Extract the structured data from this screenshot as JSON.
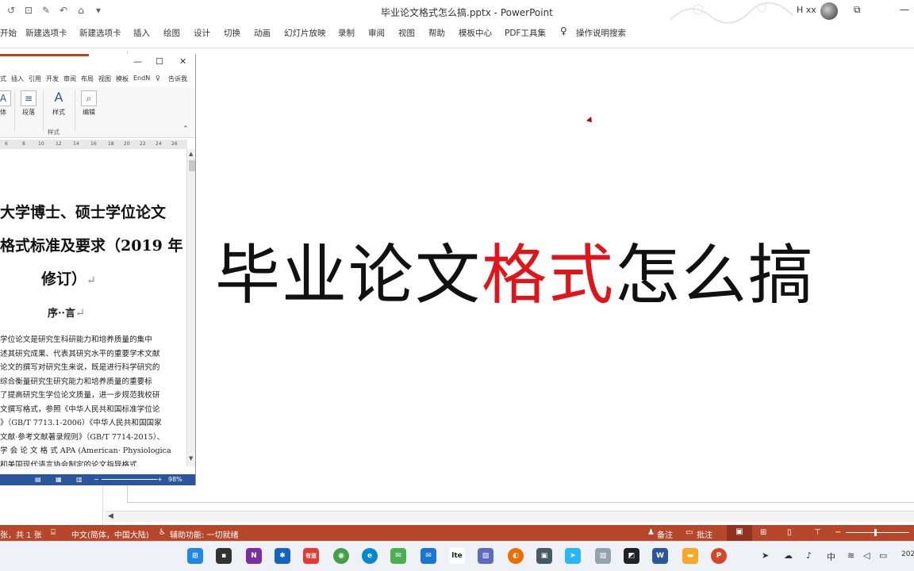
{
  "ppt": {
    "window_title": "毕业论文格式怎么搞.pptx  -  PowerPoint",
    "user_name": "H xx",
    "tabs": [
      "开始",
      "新建选项卡",
      "新建选项卡",
      "插入",
      "绘图",
      "设计",
      "切换",
      "动画",
      "幻灯片放映",
      "录制",
      "审阅",
      "视图",
      "帮助",
      "模板中心",
      "PDF工具集"
    ],
    "tell_me": "操作说明搜索"
  },
  "slide": {
    "title_part1": "毕业论文",
    "title_highlight": "格式",
    "title_part2": "怎么搞",
    "highlight_color": "#e0141b"
  },
  "word": {
    "tabs": [
      "式",
      "插入",
      "引用",
      "开发",
      "审阅",
      "布局",
      "视图",
      "模板",
      "EndN",
      "告诉我"
    ],
    "ribbon": {
      "btn_font": "体",
      "btn_paragraph": "段落",
      "btn_style": "样式",
      "btn_edit": "编辑",
      "group_style": "样式"
    },
    "ruler_ticks": [
      "6",
      "8",
      "10",
      "12",
      "14",
      "16",
      "18",
      "20",
      "22",
      "24",
      "26"
    ],
    "doc": {
      "h1": "大学博士、硕士学位论文",
      "h2": "格式标准及要求（2019 年",
      "h3": "修订）",
      "h4": "序··言",
      "body": [
        "学位论文是研究生科研能力和培养质量的集中",
        "述其研究成果、代表其研究水平的重要学术文献",
        "论文的撰写对研究生来说，既是进行科学研究的",
        "综合衡量研究生研究能力和培养质量的重要标",
        "了提高研究生学位论文质量，进一步规范我校研",
        "文撰写格式，参照《中华人民共和国标准学位论",
        "》（GB/T 7713.1-2006）《中华人民共和国国家",
        "文献·参考文献著录规则》（GB/T 7714-2015）、",
        "学 会 论 文 格 式  APA (American· Physiological·",
        "和美国现代语言协会制定的论文指导格式"
      ]
    },
    "zoom": "98%"
  },
  "status": {
    "slide_info": "张，共 1 张",
    "language": "中文(简体，中国大陆)",
    "accessibility": "辅助功能: 一切就绪",
    "notes": "备注",
    "comments": "批注"
  },
  "taskbar": {
    "ime": "中",
    "clock_partial": "202",
    "youdao": "有道",
    "lte": "lte"
  }
}
